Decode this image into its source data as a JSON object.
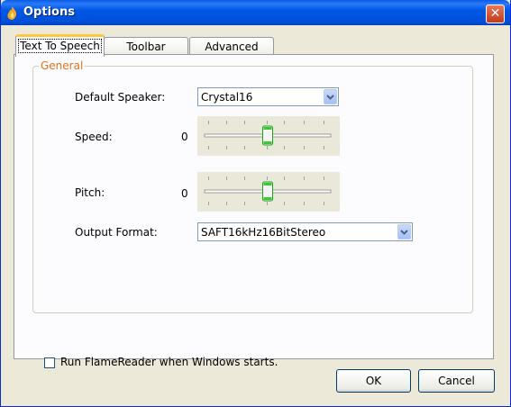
{
  "window": {
    "title": "Options",
    "close_symbol": "✕"
  },
  "tabs": [
    {
      "label": "Text To Speech",
      "active": true
    },
    {
      "label": "Toolbar",
      "active": false
    },
    {
      "label": "Advanced",
      "active": false
    }
  ],
  "general": {
    "legend": "General",
    "default_speaker": {
      "label": "Default Speaker:",
      "value": "Crystal16"
    },
    "speed": {
      "label": "Speed:",
      "value": "0",
      "level": 0.5
    },
    "pitch": {
      "label": "Pitch:",
      "value": "0",
      "level": 0.5
    },
    "output_format": {
      "label": "Output Format:",
      "value": "SAFT16kHz16BitStereo"
    }
  },
  "startup_checkbox": {
    "label": "Run FlameReader when Windows starts.",
    "checked": false
  },
  "buttons": {
    "ok": "OK",
    "cancel": "Cancel"
  },
  "colors": {
    "titlebar": "#0058e6",
    "group_label": "#e7711b",
    "active_tab_accent": "#ffc83c"
  }
}
